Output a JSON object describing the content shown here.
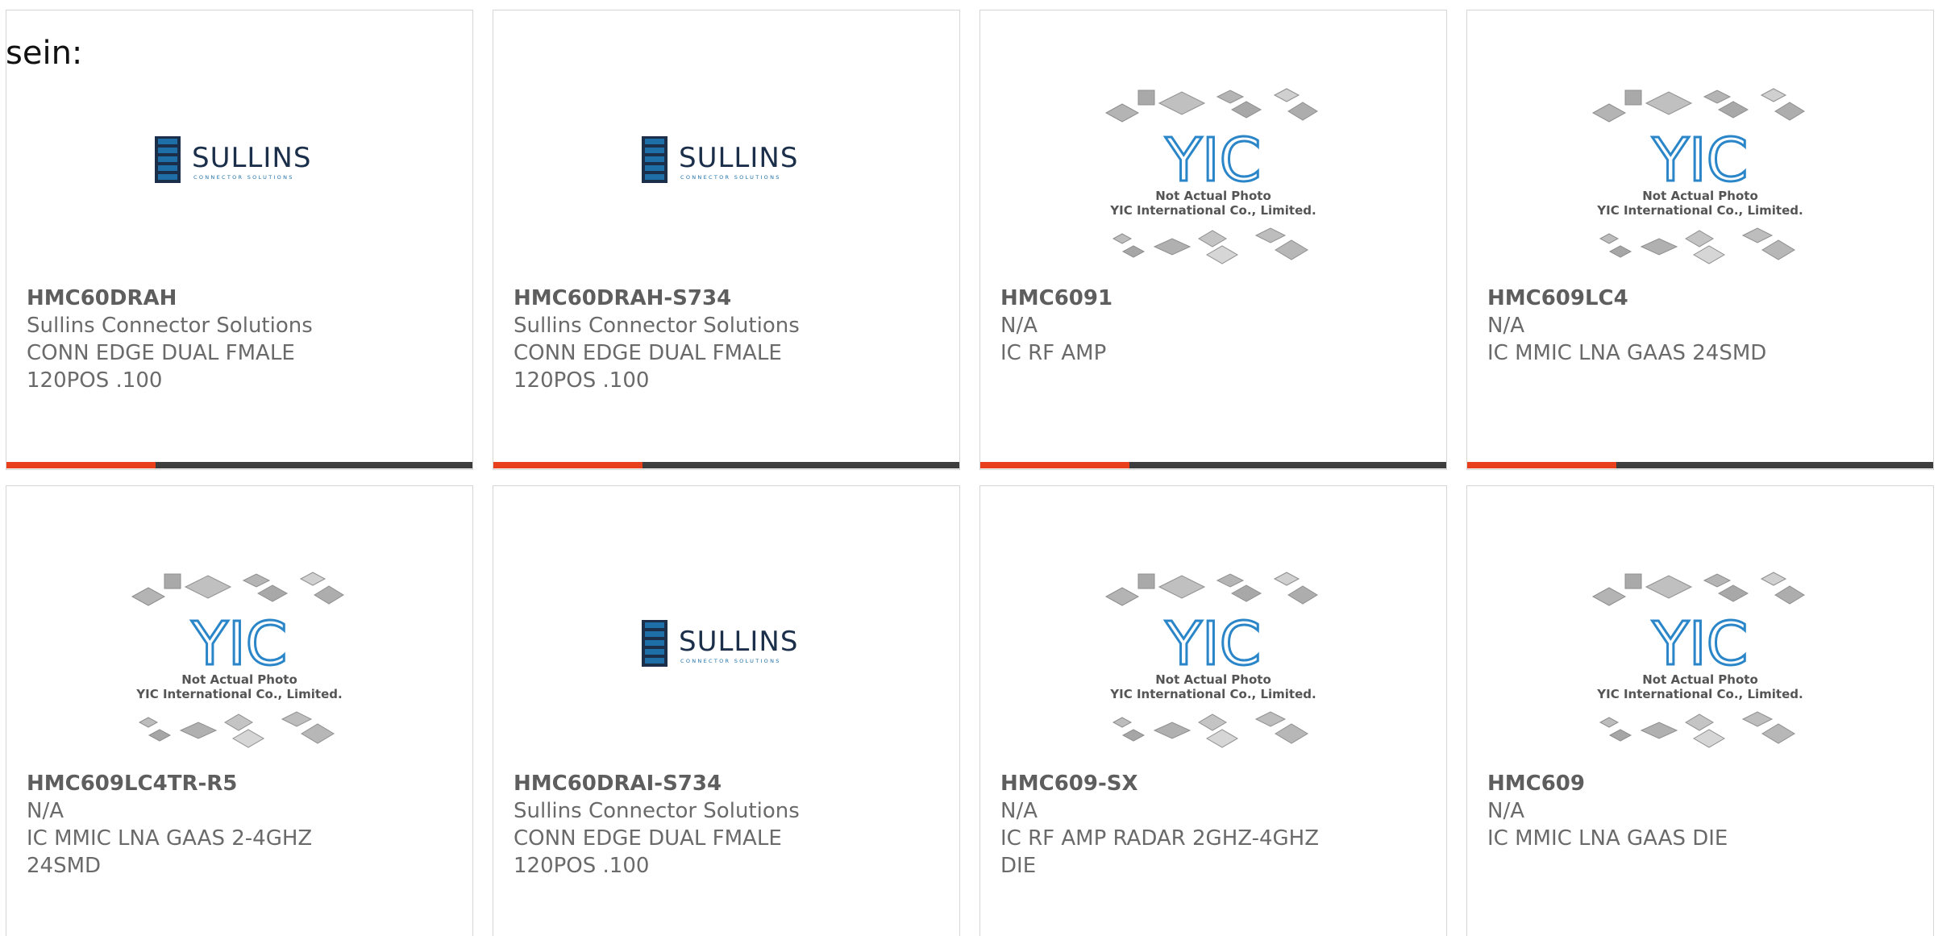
{
  "fragment_label": "sein:",
  "colors": {
    "progress_active": "#e8401c",
    "progress_track": "#3d3d3d",
    "sullins_blue": "#1e6fa8",
    "yic_blue": "#2a86c8"
  },
  "progress_fraction": 0.32,
  "products": [
    {
      "part": "HMC60DRAH",
      "manufacturer": "Sullins Connector Solutions",
      "desc_1": "CONN EDGE DUAL FMALE",
      "desc_2": "120POS .100",
      "image_type": "sullins-logo",
      "has_progress": true
    },
    {
      "part": "HMC60DRAH-S734",
      "manufacturer": "Sullins Connector Solutions",
      "desc_1": "CONN EDGE DUAL FMALE",
      "desc_2": "120POS .100",
      "image_type": "sullins-logo",
      "has_progress": true
    },
    {
      "part": "HMC6091",
      "manufacturer": "N/A",
      "desc_1": "IC RF AMP",
      "desc_2": "",
      "image_type": "yic-placeholder",
      "has_progress": true
    },
    {
      "part": "HMC609LC4",
      "manufacturer": "N/A",
      "desc_1": "IC MMIC LNA GAAS 24SMD",
      "desc_2": "",
      "image_type": "yic-placeholder",
      "has_progress": true
    },
    {
      "part": "HMC609LC4TR-R5",
      "manufacturer": "N/A",
      "desc_1": "IC MMIC LNA GAAS 2-4GHZ",
      "desc_2": "24SMD",
      "image_type": "yic-placeholder",
      "has_progress": false
    },
    {
      "part": "HMC60DRAI-S734",
      "manufacturer": "Sullins Connector Solutions",
      "desc_1": "CONN EDGE DUAL FMALE",
      "desc_2": "120POS .100",
      "image_type": "sullins-logo",
      "has_progress": false
    },
    {
      "part": "HMC609-SX",
      "manufacturer": "N/A",
      "desc_1": "IC RF AMP RADAR 2GHZ-4GHZ",
      "desc_2": "DIE",
      "image_type": "yic-placeholder",
      "has_progress": false
    },
    {
      "part": "HMC609",
      "manufacturer": "N/A",
      "desc_1": "IC MMIC LNA GAAS DIE",
      "desc_2": "",
      "image_type": "yic-placeholder",
      "has_progress": false
    }
  ],
  "sullins_logo": {
    "wordmark": "SULLINS",
    "tagline": "CONNECTOR SOLUTIONS"
  },
  "yic_placeholder": {
    "mark": "YIC",
    "caption_1": "Not Actual Photo",
    "caption_2": "YIC International Co., Limited."
  }
}
